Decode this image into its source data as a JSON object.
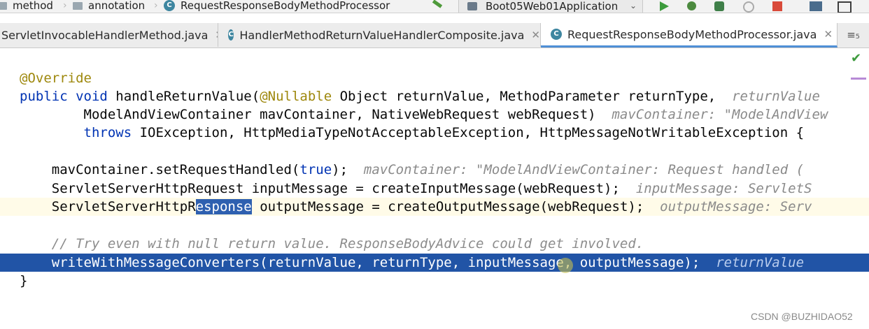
{
  "breadcrumb": {
    "items": [
      "method",
      "annotation",
      "RequestResponseBodyMethodProcessor"
    ]
  },
  "run_config": {
    "label": "Boot05Web01Application"
  },
  "tabs": [
    {
      "label": "ServletInvocableHandlerMethod.java",
      "active": false
    },
    {
      "label": "HandlerMethodReturnValueHandlerComposite.java",
      "active": false
    },
    {
      "label": "RequestResponseBodyMethodProcessor.java",
      "active": true
    }
  ],
  "tab_overflow": {
    "label": "≡₅"
  },
  "code": {
    "l1": "@Override",
    "l2_kw": "public void",
    "l2_a": " handleReturnValue(",
    "l2_ann": "@Nullable",
    "l2_b": " Object returnValue, MethodParameter returnType,",
    "l2_hint": "  returnValue",
    "l3": "        ModelAndViewContainer mavContainer, NativeWebRequest webRequest)",
    "l3_hint": "  mavContainer: \"ModelAndView",
    "l4_kw": "throws",
    "l4": " IOException, HttpMediaTypeNotAcceptableException, HttpMessageNotWritableException {",
    "l6_a": "    mavContainer.setRequestHandled(",
    "l6_kw": "true",
    "l6_b": ");",
    "l6_hint": "  mavContainer: \"ModelAndViewContainer: Request handled (",
    "l7": "    ServletServerHttpRequest inputMessage = createInputMessage(webRequest);",
    "l7_hint": "  inputMessage: ServletS",
    "l8_a": "    ServletServerHttpR",
    "l8_sel": "esponse",
    "l8_b": " outputMessage = createOutputMessage(webRequest);",
    "l8_hint": "  outputMessage: Serv",
    "l10": "    // Try even with null return value. ResponseBodyAdvice could get involved.",
    "l11": "    writeWithMessageConverters(returnValue, returnType, inputMessage, outputMessage);",
    "l11_hint": "  returnValue",
    "l12": "}"
  },
  "watermark": "CSDN @BUZHIDAO52"
}
